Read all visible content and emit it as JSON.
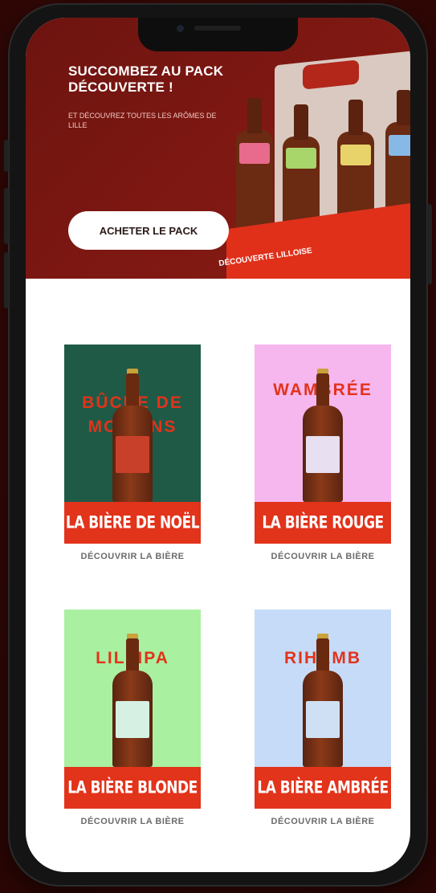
{
  "hero": {
    "title": "SUCCOMBEZ AU PACK DÉCOUVERTE !",
    "subtitle": "ET DÉCOUVREZ TOUTES LES ARÔMES DE LILLE",
    "cta_label": "ACHETER LE PACK",
    "pack_label": "DÉCOUVERTE LILLOISE"
  },
  "products": [
    {
      "name": "BÛCHE DE MOULINS",
      "banner": "LA BIÈRE DE NOËL",
      "link": "DÉCOUVRIR LA BIÈRE",
      "bg_color": "#1f5a47",
      "tag_color": "#c8402a"
    },
    {
      "name": "WAMBRÉE",
      "banner": "LA BIÈRE ROUGE",
      "link": "DÉCOUVRIR LA BIÈRE",
      "bg_color": "#f6b6ee",
      "tag_color": "#e8dff0"
    },
    {
      "name": "LILLIPA",
      "banner": "LA BIÈRE BLONDE",
      "link": "DÉCOUVRIR LA BIÈRE",
      "bg_color": "#a9f0a0",
      "tag_color": "#d6f0e4"
    },
    {
      "name": "RIHAMB",
      "banner": "LA BIÈRE AMBRÉE",
      "link": "DÉCOUVRIR LA BIÈRE",
      "bg_color": "#c6dbf7",
      "tag_color": "#cfe0f4"
    }
  ],
  "colors": {
    "accent": "#e2331b",
    "hero_bg": "#7c1712",
    "background": "#3d0a06"
  }
}
